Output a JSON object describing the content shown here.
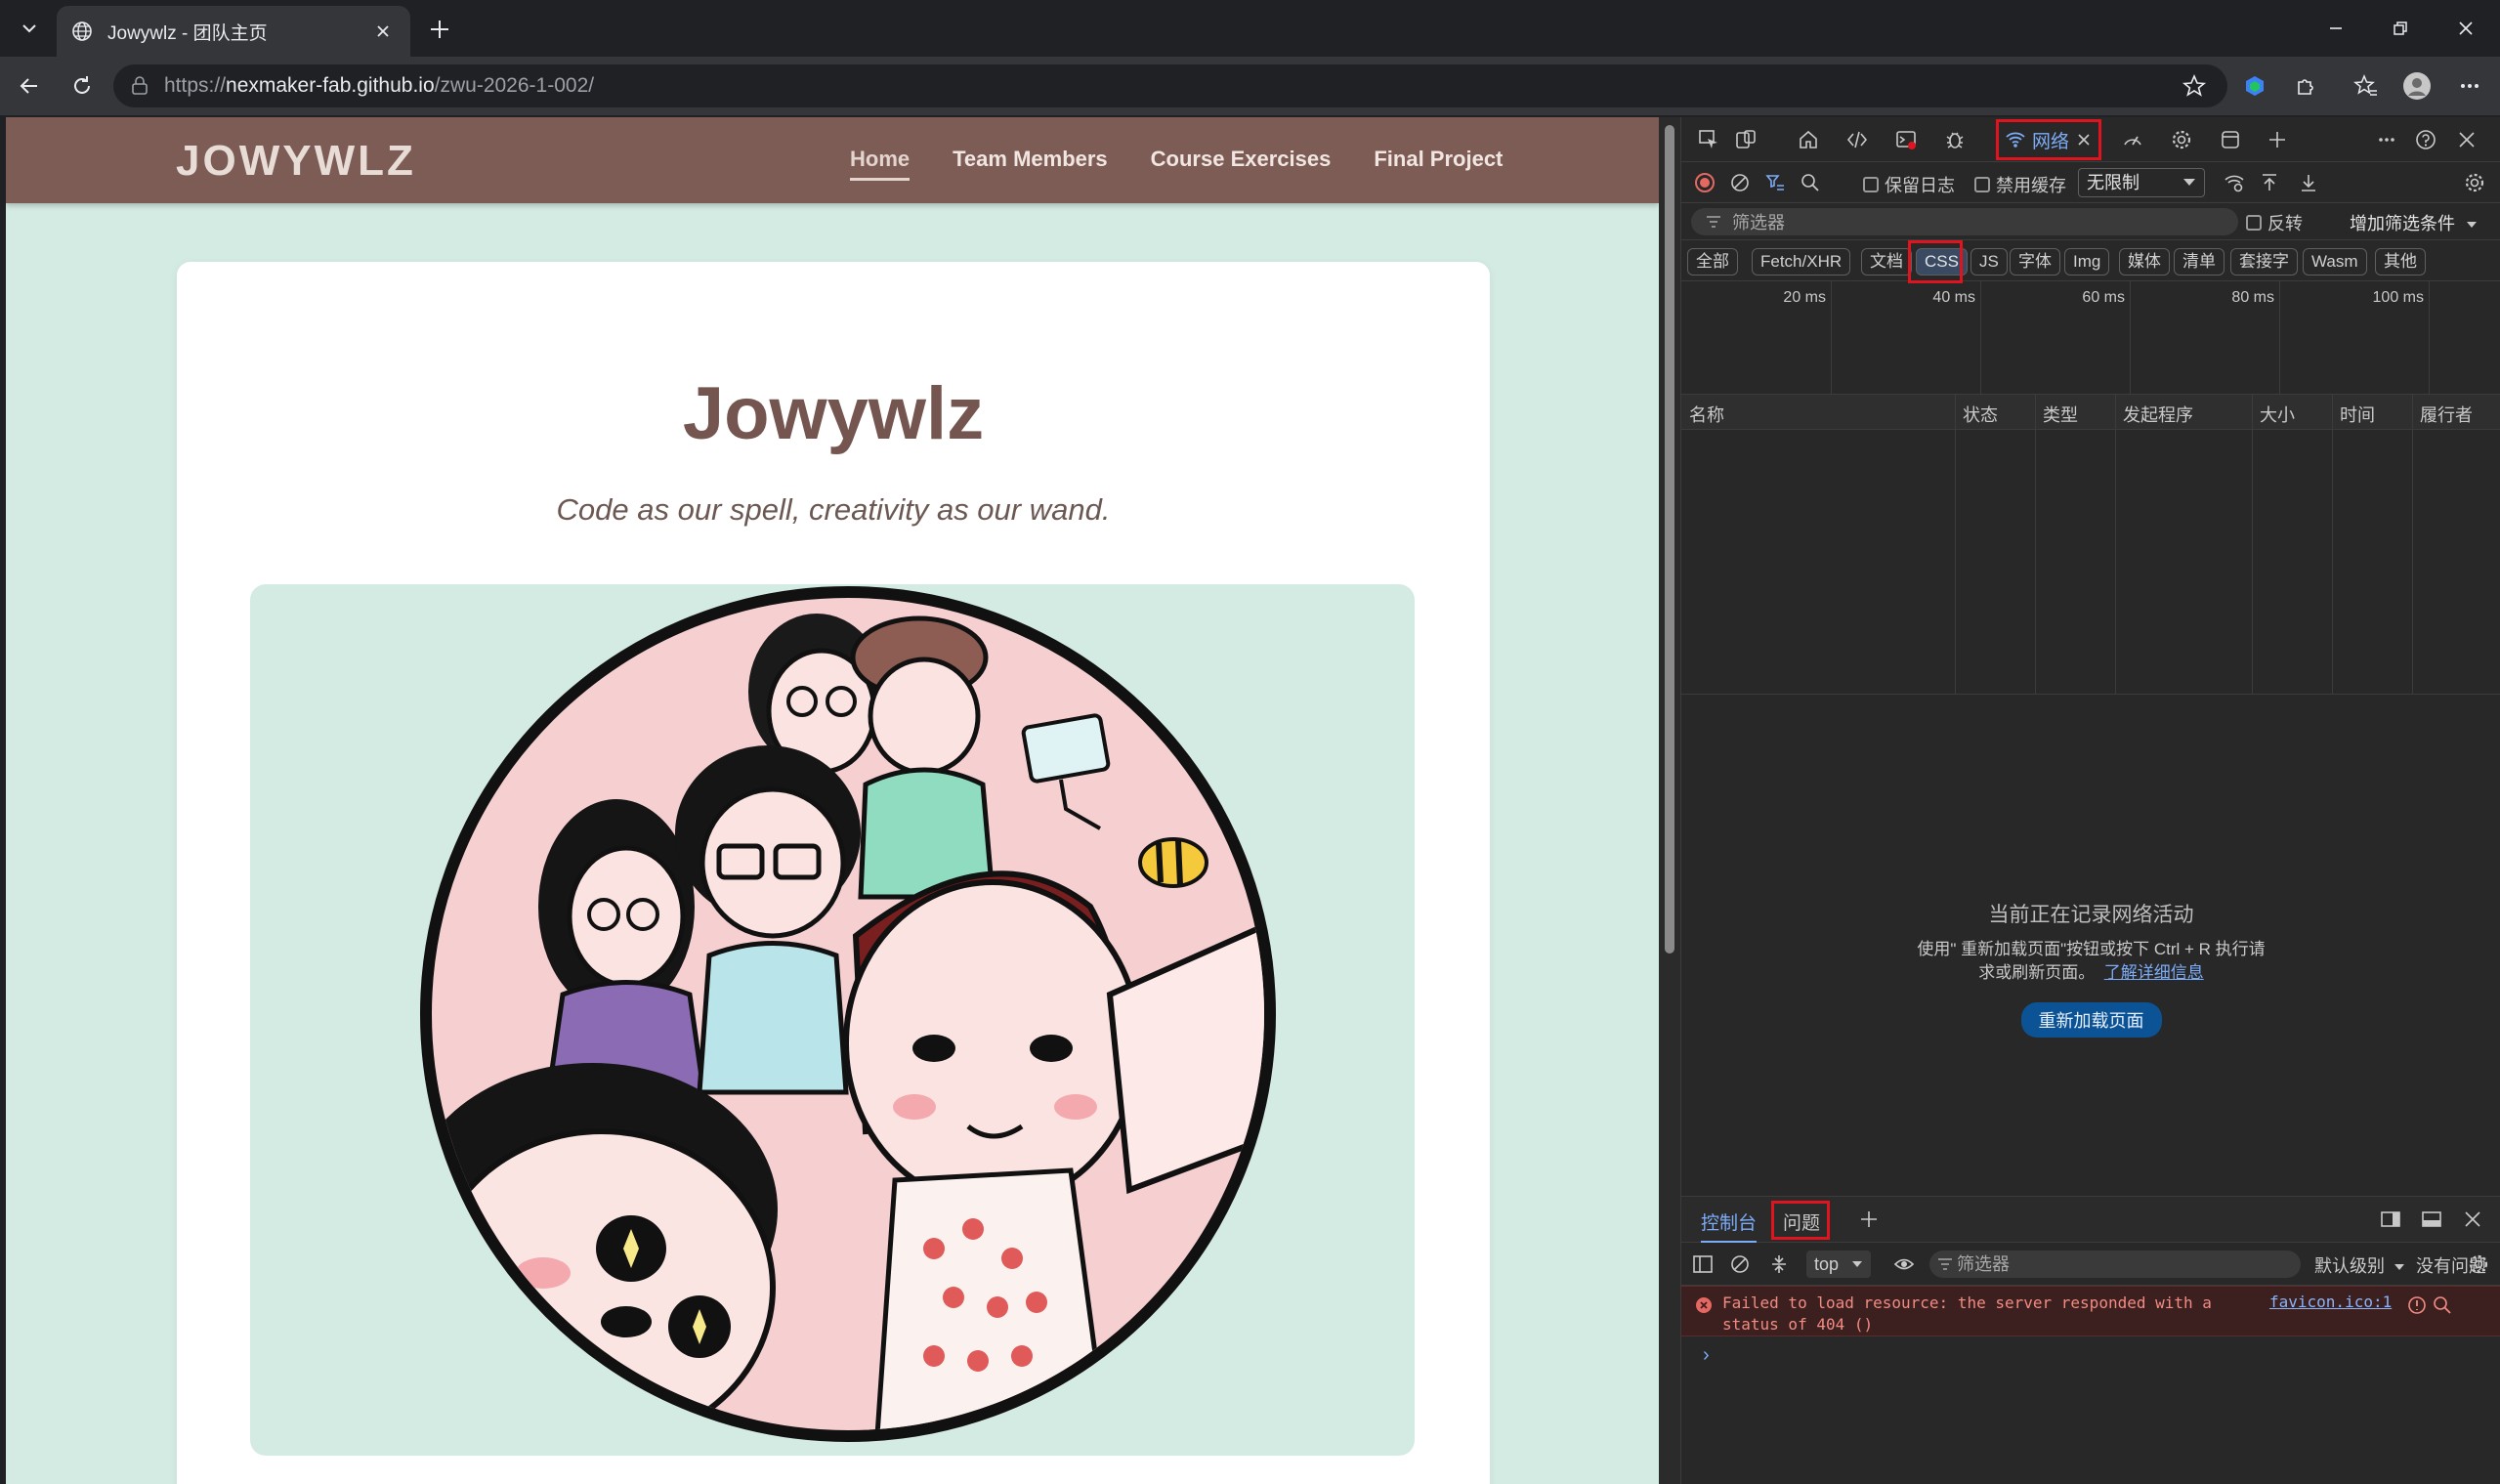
{
  "browser": {
    "tab_title": "Jowywlz - 团队主页",
    "url_prefix": "https://",
    "url_host": "nexmaker-fab.github.io",
    "url_path": "/zwu-2026-1-002/"
  },
  "site": {
    "brand": "JOWYWLZ",
    "nav": [
      "Home",
      "Team Members",
      "Course Exercises",
      "Final Project"
    ],
    "active_nav": "Home",
    "hero_title": "Jowywlz",
    "hero_subtitle": "Code as our spell, creativity as our wand."
  },
  "devtools": {
    "network_tab": "网络",
    "preserve_log": "保留日志",
    "disable_cache": "禁用缓存",
    "throttle": "无限制",
    "filter_placeholder": "筛选器",
    "invert": "反转",
    "more_filters": "增加筛选条件",
    "types": [
      "全部",
      "Fetch/XHR",
      "文档",
      "CSS",
      "JS",
      "字体",
      "Img",
      "媒体",
      "清单",
      "套接字",
      "Wasm",
      "其他"
    ],
    "selected_type": "CSS",
    "timeline": [
      "20 ms",
      "40 ms",
      "60 ms",
      "80 ms",
      "100 ms"
    ],
    "columns": [
      "名称",
      "状态",
      "类型",
      "发起程序",
      "大小",
      "时间",
      "履行者"
    ],
    "empty_title": "当前正在记录网络活动",
    "empty_desc_1": "使用\" 重新加载页面\"按钮或按下 Ctrl + R 执行请",
    "empty_desc_2": "求或刷新页面。",
    "learn_more": "了解详细信息",
    "reload_button": "重新加载页面",
    "drawer_tabs": [
      "控制台",
      "问题"
    ],
    "context": "top",
    "console_filter": "筛选器",
    "default_levels": "默认级别",
    "no_issues": "没有问题",
    "error_message": "Failed to load resource: the server responded with a status of 404 ()",
    "error_source": "favicon.ico:1",
    "accent": "#7cacf8",
    "highlight": "#e0141e"
  }
}
